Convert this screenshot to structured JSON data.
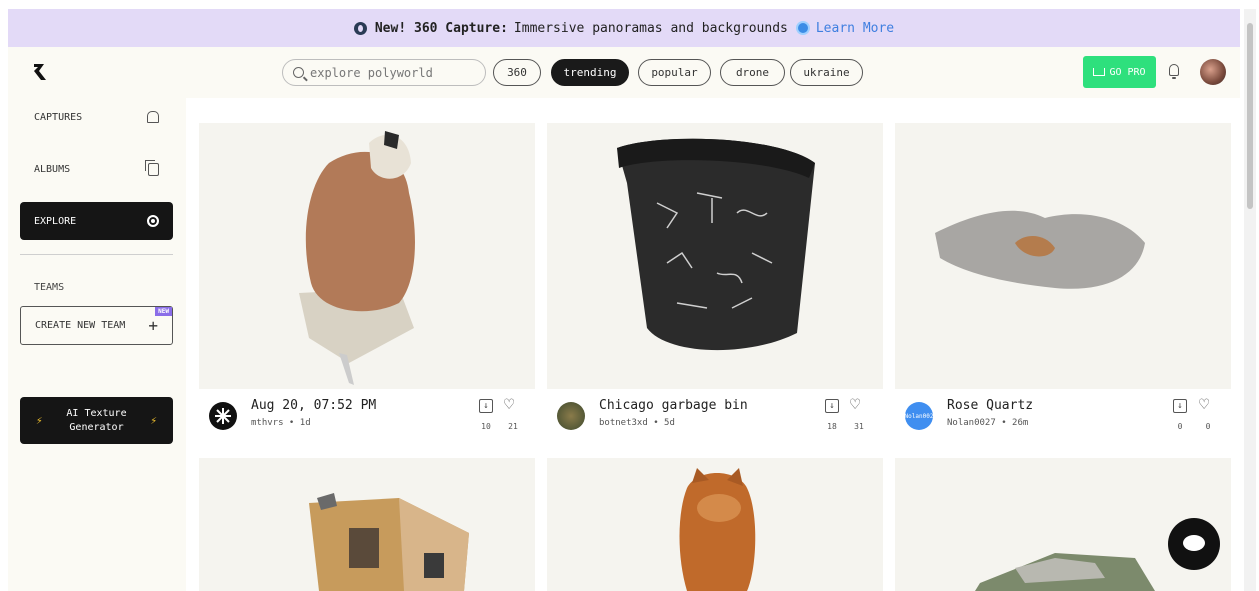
{
  "banner": {
    "headline": "New! 360 Capture:",
    "text": "Immersive panoramas and backgrounds",
    "link": "Learn More"
  },
  "search": {
    "placeholder": "explore polyworld"
  },
  "chips": [
    {
      "label": "360"
    },
    {
      "label": "trending",
      "active": true
    },
    {
      "label": "popular"
    },
    {
      "label": "drone"
    },
    {
      "label": "ukraine"
    }
  ],
  "header": {
    "go_pro": "GO PRO"
  },
  "sidebar": {
    "items": [
      {
        "label": "CAPTURES",
        "icon": "home-icon"
      },
      {
        "label": "ALBUMS",
        "icon": "albums-icon"
      },
      {
        "label": "EXPLORE",
        "icon": "globe-icon",
        "active": true
      }
    ],
    "teams_label": "TEAMS",
    "create_team": "CREATE NEW TEAM",
    "new_badge": "NEW",
    "ai_texture_line1": "AI Texture",
    "ai_texture_line2": "Generator"
  },
  "cards": [
    {
      "title": "Aug 20, 07:52 PM",
      "user": "mthvrs",
      "age": "1d",
      "downloads": "10",
      "likes": "21",
      "avatar_color": "#111111"
    },
    {
      "title": "Chicago garbage bin",
      "user": "botnet3xd",
      "age": "5d",
      "downloads": "18",
      "likes": "31",
      "avatar_color": "#5a6b3a"
    },
    {
      "title": "Rose Quartz",
      "user": "Nolan0027",
      "age": "26m",
      "downloads": "0",
      "likes": "0",
      "avatar_color": "#3f8ef0",
      "avatar_text": "Nolan002"
    }
  ],
  "colors": {
    "accent_green": "#2ee07d",
    "banner_bg": "#e3daf7",
    "link_blue": "#3f7fe0"
  }
}
